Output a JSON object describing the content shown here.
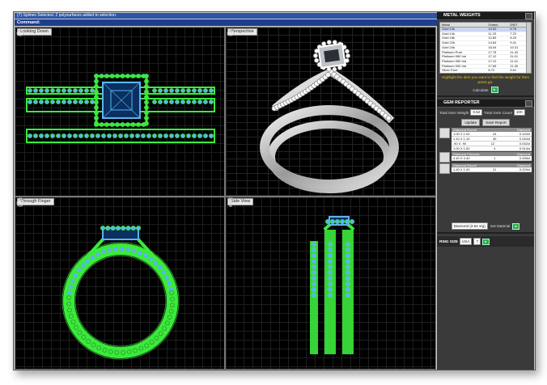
{
  "status": {
    "line1": "(7) Splines Selected. 2 polysurfaces added to selection.",
    "line2": "Command:"
  },
  "viewports": {
    "top": "Looking Down",
    "perspective": "Perspective",
    "front": "Through Finger",
    "right": "Side View"
  },
  "metal_weights": {
    "title": "METAL WEIGHTS",
    "columns": [
      "Metal",
      "Grams",
      "DWT"
    ],
    "rows": [
      [
        "Gold 10k",
        "10.52",
        "6.76"
      ],
      [
        "Gold 14k",
        "11.23",
        "7.22"
      ],
      [
        "Gold 18k",
        "12.89",
        "8.29"
      ],
      [
        "Gold 22k",
        "14.64",
        "9.41"
      ],
      [
        "Gold 24k",
        "16.04",
        "10.31"
      ],
      [
        "Platinum Pure",
        "17.78",
        "11.43"
      ],
      [
        "Platinum 950 Ind",
        "17.12",
        "11.01"
      ],
      [
        "Platinum 950 Irid",
        "17.12",
        "11.01"
      ],
      [
        "Platinum 900 Irid",
        "17.65",
        "11.35"
      ],
      [
        "Silver Pure",
        "8.72",
        "5.61"
      ],
      [
        "Silver Sterling",
        "8.49",
        "5.46"
      ]
    ],
    "hint": "Highlight the item you want to find the weight for then press go.",
    "calculate": "Calculate",
    "go": "Go"
  },
  "gem_reporter": {
    "title": "GEM REPORTER",
    "total_weight_label": "Total Gem Weight",
    "total_weight": "0.52",
    "total_count_label": "Total Gem Count",
    "total_count": "100",
    "update": "Update",
    "save_report": "Save Report",
    "gems": [
      {
        "name": "Diamond Round",
        "type": "Diamond",
        "rows": [
          [
            "1.00 X 1.00",
            "24",
            "0.120ct"
          ],
          [
            "1.10 X 1.10",
            "40",
            "0.240ct"
          ],
          [
            ".90 X .90",
            "12",
            "0.032ct"
          ],
          [
            "1.00 X 1.00",
            "4",
            "0.014ct"
          ]
        ]
      },
      {
        "name": "Diamond Princess",
        "type": "Diamond",
        "rows": [
          [
            "4.40 X 4.40",
            "1",
            "0.496ct"
          ]
        ]
      },
      {
        "name": "Diamond Round",
        "type": "Diamond",
        "rows": [
          [
            "1.40 X 1.40",
            "21",
            "0.229ct"
          ]
        ]
      }
    ],
    "material_value": "Diamond (3.52 s/g)",
    "set_material": "Set Material"
  },
  "ring_size": {
    "title": "RING SIZE",
    "system": "USA",
    "size": "7"
  },
  "colors": {
    "panel_bg": "#3a3a3a",
    "status_bar": "#2d56a8",
    "wire_green": "#3bea3b",
    "wire_blue": "#5bb4f0",
    "accent_yellow": "#e6c31d"
  },
  "icons": {
    "viewport": "ring-view-icon",
    "go": "go-arrow-icon"
  }
}
